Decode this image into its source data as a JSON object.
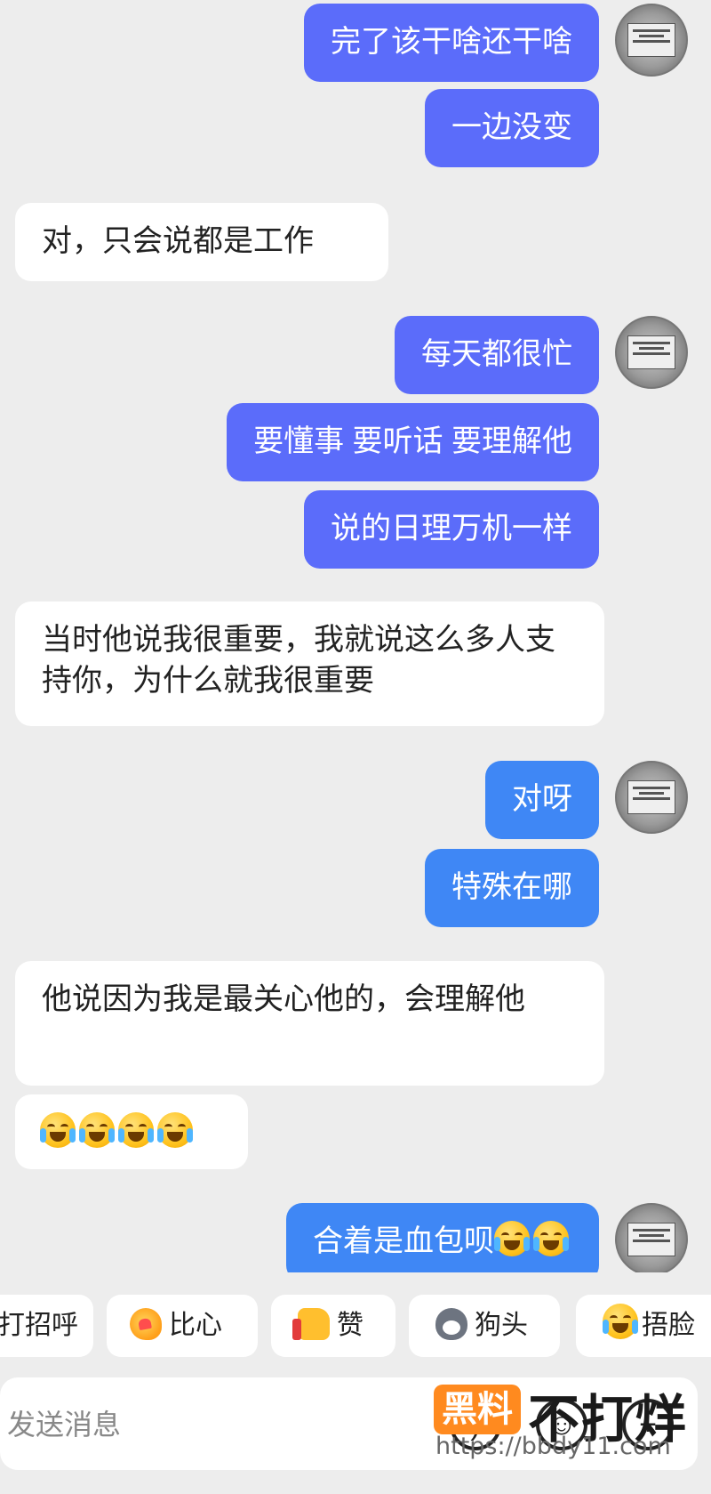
{
  "messages": {
    "m1": "完了该干啥还干啥",
    "m2": "一边没变",
    "m3": "对，只会说都是工作",
    "m4": "每天都很忙",
    "m5": "要懂事 要听话 要理解他",
    "m6": "说的日理万机一样",
    "m7": "当时他说我很重要，我就说这么多人支持你，为什么就我很重要",
    "m8": "对呀",
    "m9": "特殊在哪",
    "m10": "他说因为我是最关心他的，会理解他",
    "m12": "合着是血包呗"
  },
  "quick_replies": {
    "greet": "打招呼",
    "bixin": "比心",
    "zan": "赞",
    "goutou": "狗头",
    "wulian": "捂脸"
  },
  "input": {
    "placeholder": "发送消息"
  },
  "watermark": {
    "badge": "黑料",
    "text": "不打烊",
    "url": "https://bbdy11.com"
  },
  "colors": {
    "outgoing_bubble": "#5b6cfa",
    "outgoing_bubble_alt": "#3f87f5",
    "incoming_bubble": "#ffffff",
    "background": "#ededed",
    "watermark_accent": "#ff8a1f"
  },
  "icons": [
    "laugh-cry-emoji",
    "blush-heart-emoji",
    "thumbs-up-emoji",
    "doge-emoji",
    "facepalm-emoji",
    "voice-icon",
    "emoji-icon",
    "plus-icon"
  ]
}
